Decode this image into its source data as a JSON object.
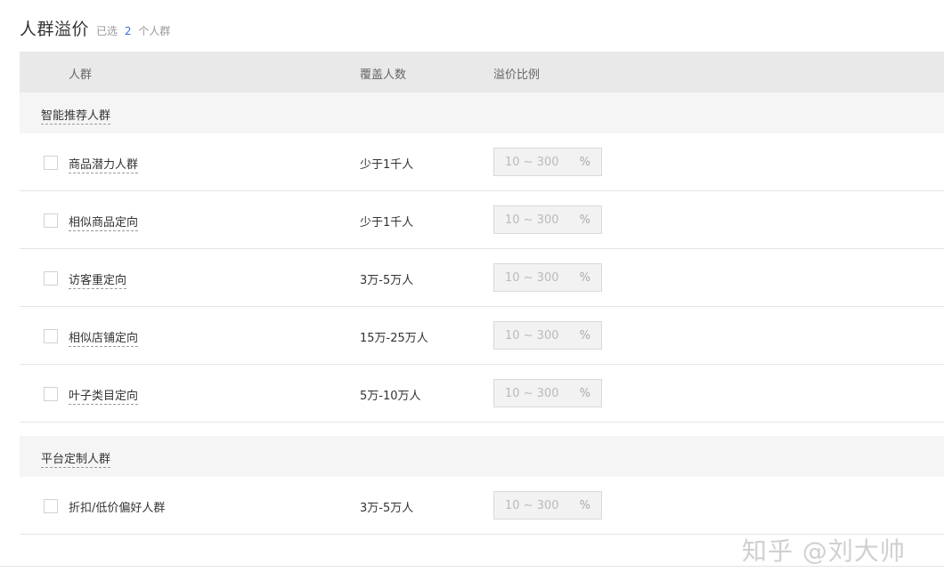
{
  "header": {
    "title": "人群溢价",
    "selected_prefix": "已选",
    "selected_count": "2",
    "selected_suffix": "个人群"
  },
  "table": {
    "columns": {
      "name": "人群",
      "cover": "覆盖人数",
      "premium": "溢价比例"
    },
    "premium_placeholder": "10 ~ 300",
    "premium_unit": "%",
    "groups": [
      {
        "label": "智能推荐人群",
        "rows": [
          {
            "name": "商品潜力人群",
            "cover": "少于1千人",
            "checked": false
          },
          {
            "name": "相似商品定向",
            "cover": "少于1千人",
            "checked": false
          },
          {
            "name": "访客重定向",
            "cover": "3万-5万人",
            "checked": false
          },
          {
            "name": "相似店铺定向",
            "cover": "15万-25万人",
            "checked": false
          },
          {
            "name": "叶子类目定向",
            "cover": "5万-10万人",
            "checked": false
          }
        ]
      },
      {
        "label": "平台定制人群",
        "rows": [
          {
            "name": "折扣/低价偏好人群",
            "cover": "3万-5万人",
            "checked": false
          }
        ]
      }
    ]
  },
  "watermark": "知乎 @刘大帅"
}
